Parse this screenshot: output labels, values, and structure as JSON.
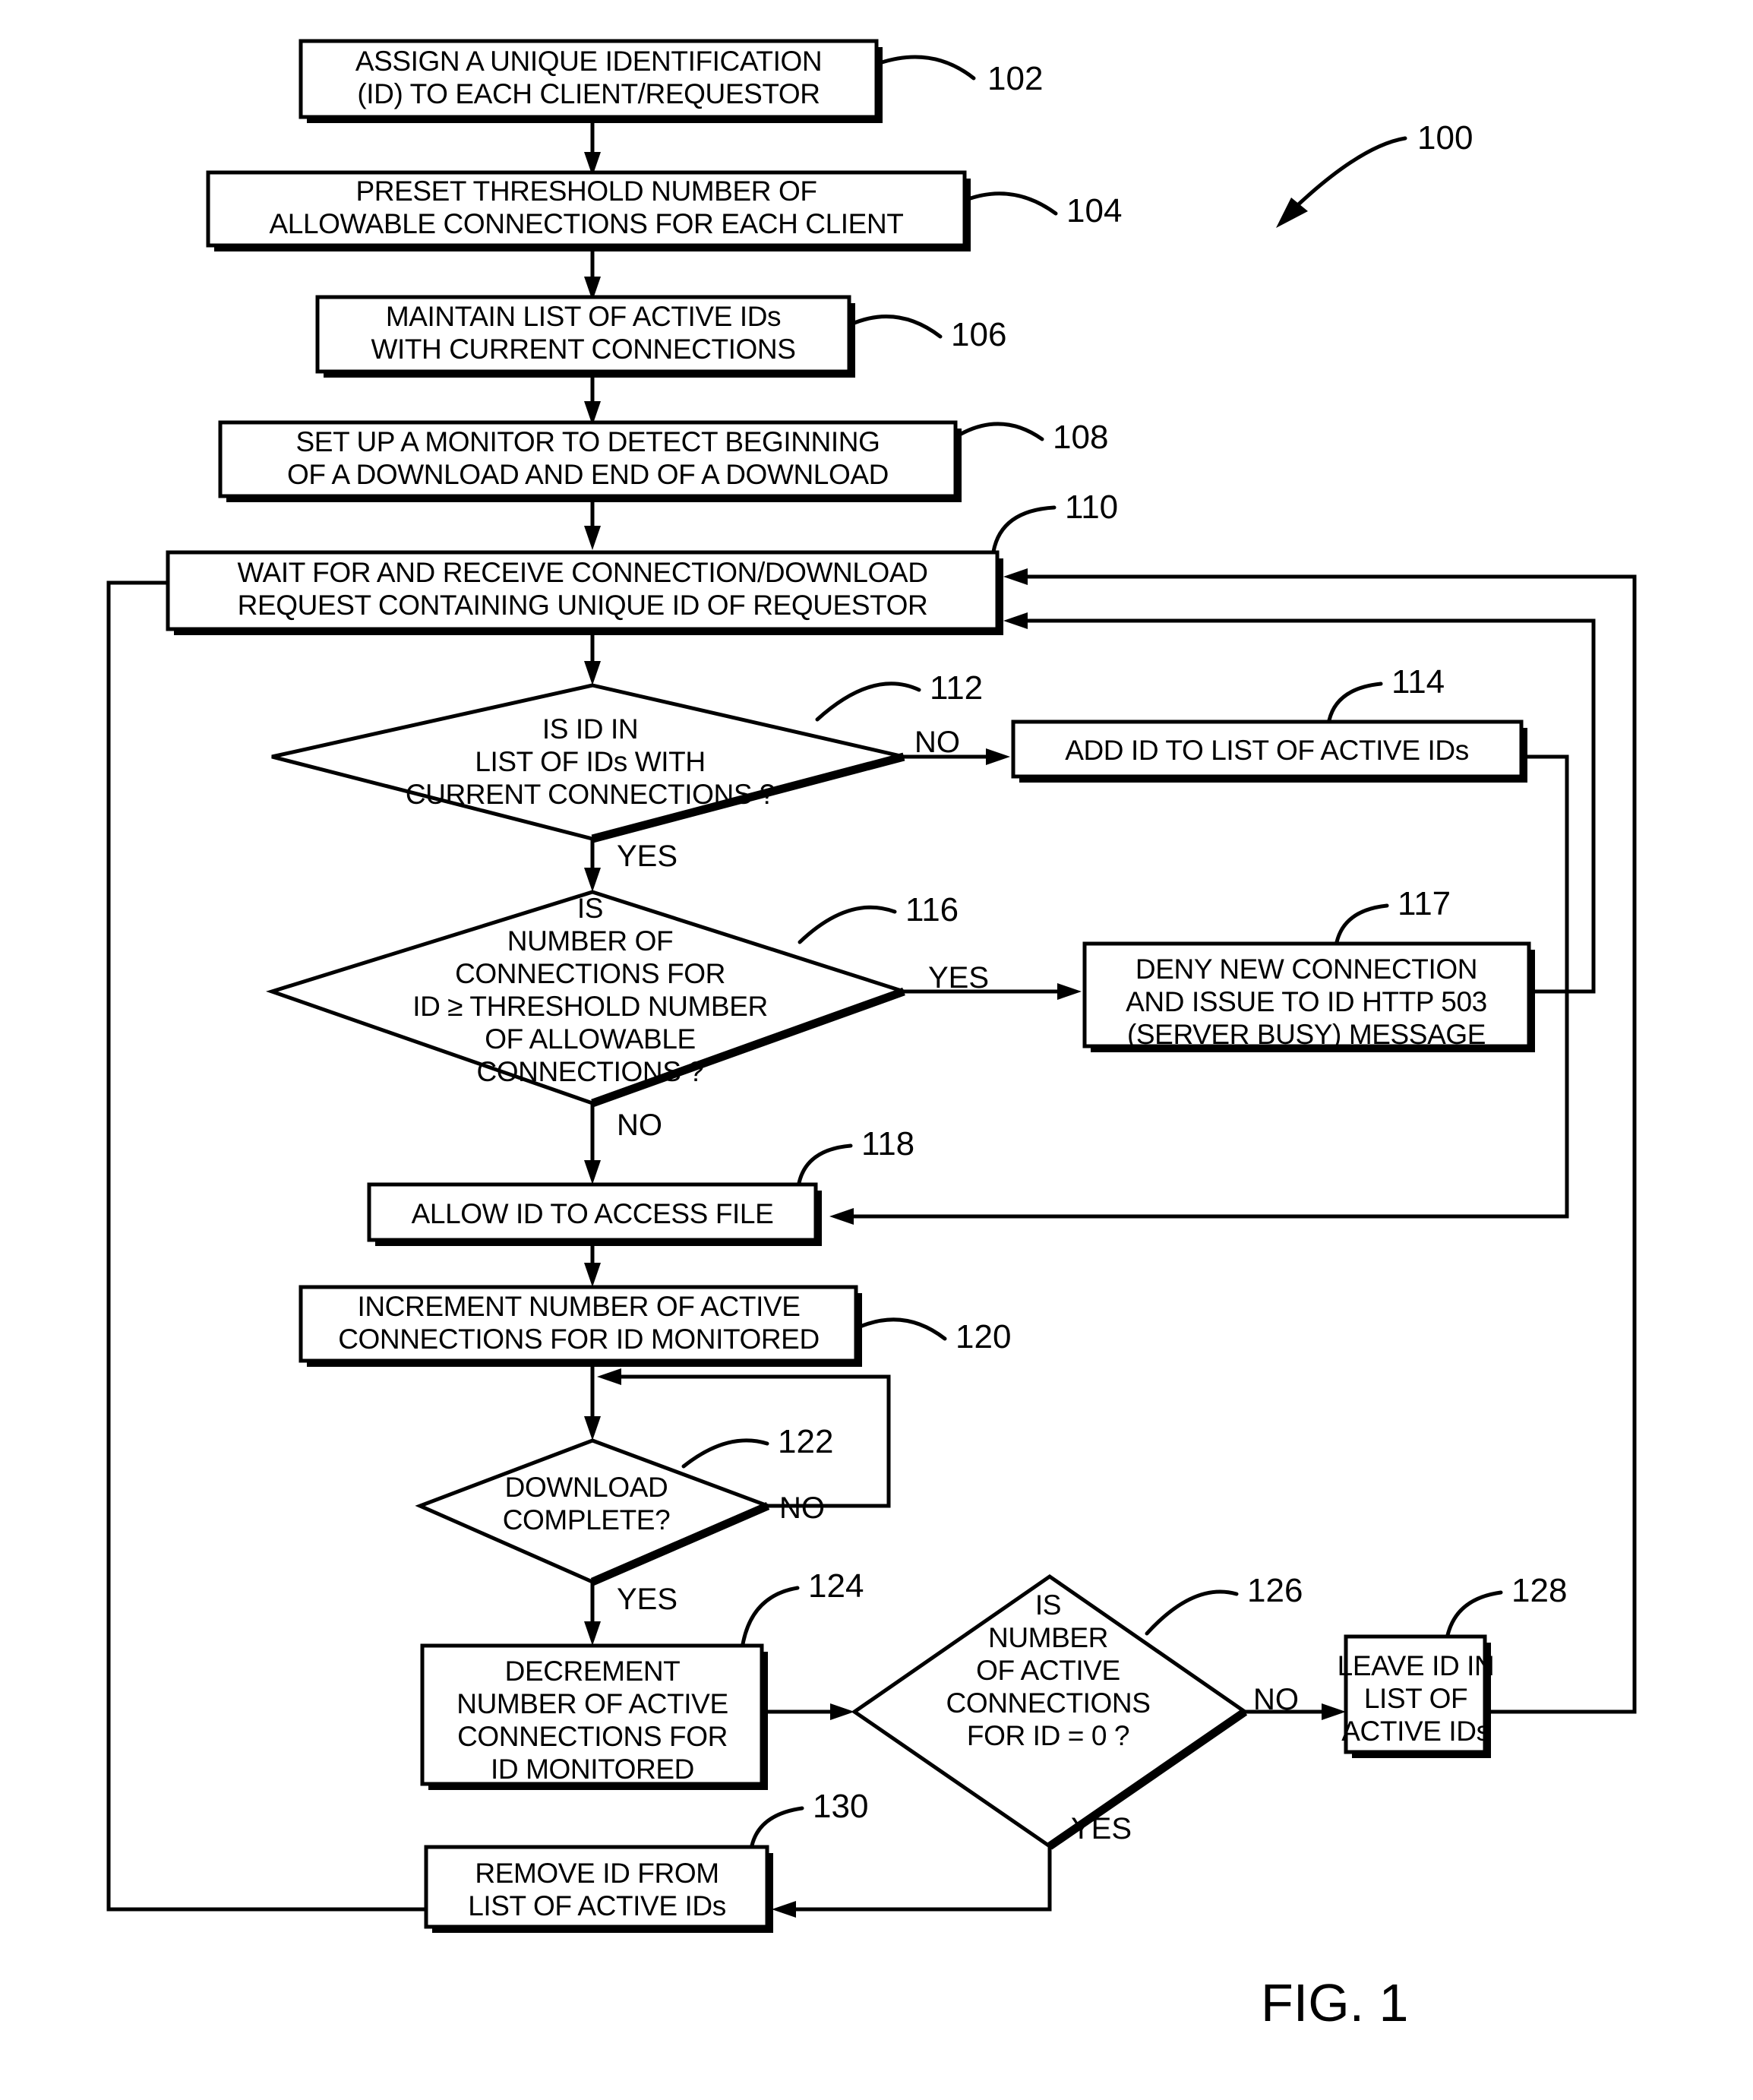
{
  "figure": {
    "label": "FIG. 1",
    "overall_ref": "100"
  },
  "nodes": [
    {
      "id": "n102",
      "ref": "102",
      "shape": "process",
      "lines": [
        "ASSIGN A UNIQUE IDENTIFICATION",
        "(ID) TO EACH CLIENT/REQUESTOR"
      ]
    },
    {
      "id": "n104",
      "ref": "104",
      "shape": "process",
      "lines": [
        "PRESET THRESHOLD NUMBER OF",
        "ALLOWABLE CONNECTIONS FOR EACH CLIENT"
      ]
    },
    {
      "id": "n106",
      "ref": "106",
      "shape": "process",
      "lines": [
        "MAINTAIN LIST OF ACTIVE IDs",
        "WITH CURRENT CONNECTIONS"
      ]
    },
    {
      "id": "n108",
      "ref": "108",
      "shape": "process",
      "lines": [
        "SET UP A MONITOR TO DETECT BEGINNING",
        "OF A DOWNLOAD AND END OF A DOWNLOAD"
      ]
    },
    {
      "id": "n110",
      "ref": "110",
      "shape": "process",
      "lines": [
        "WAIT FOR AND RECEIVE CONNECTION/DOWNLOAD",
        "REQUEST CONTAINING UNIQUE ID OF REQUESTOR"
      ]
    },
    {
      "id": "n112",
      "ref": "112",
      "shape": "decision",
      "lines": [
        "IS ID IN",
        "LIST OF IDs WITH",
        "CURRENT CONNECTIONS ?"
      ]
    },
    {
      "id": "n114",
      "ref": "114",
      "shape": "process",
      "lines": [
        "ADD ID TO LIST OF ACTIVE IDs"
      ]
    },
    {
      "id": "n116",
      "ref": "116",
      "shape": "decision",
      "lines": [
        "IS",
        "NUMBER OF",
        "CONNECTIONS FOR",
        "ID ≥ THRESHOLD NUMBER",
        "OF ALLOWABLE",
        "CONNECTIONS ?"
      ]
    },
    {
      "id": "n117",
      "ref": "117",
      "shape": "process",
      "lines": [
        "DENY NEW CONNECTION",
        "AND ISSUE TO ID HTTP 503",
        "(SERVER BUSY) MESSAGE"
      ]
    },
    {
      "id": "n118",
      "ref": "118",
      "shape": "process",
      "lines": [
        "ALLOW ID TO ACCESS FILE"
      ]
    },
    {
      "id": "n120",
      "ref": "120",
      "shape": "process",
      "lines": [
        "INCREMENT NUMBER OF ACTIVE",
        "CONNECTIONS FOR ID MONITORED"
      ]
    },
    {
      "id": "n122",
      "ref": "122",
      "shape": "decision",
      "lines": [
        "DOWNLOAD",
        "COMPLETE?"
      ]
    },
    {
      "id": "n124",
      "ref": "124",
      "shape": "process",
      "lines": [
        "DECREMENT",
        "NUMBER OF ACTIVE",
        "CONNECTIONS FOR",
        "ID MONITORED"
      ]
    },
    {
      "id": "n126",
      "ref": "126",
      "shape": "decision",
      "lines": [
        "IS",
        "NUMBER",
        "OF ACTIVE",
        "CONNECTIONS",
        "FOR ID = 0 ?"
      ]
    },
    {
      "id": "n128",
      "ref": "128",
      "shape": "process",
      "lines": [
        "LEAVE ID IN",
        "LIST OF",
        "ACTIVE IDs"
      ]
    },
    {
      "id": "n130",
      "ref": "130",
      "shape": "process",
      "lines": [
        "REMOVE ID FROM",
        "LIST OF ACTIVE IDs"
      ]
    }
  ],
  "branch_labels": {
    "b112_no": "NO",
    "b112_yes": "YES",
    "b116_yes": "YES",
    "b116_no": "NO",
    "b122_no": "NO",
    "b122_yes": "YES",
    "b126_no": "NO",
    "b126_yes": "YES"
  }
}
